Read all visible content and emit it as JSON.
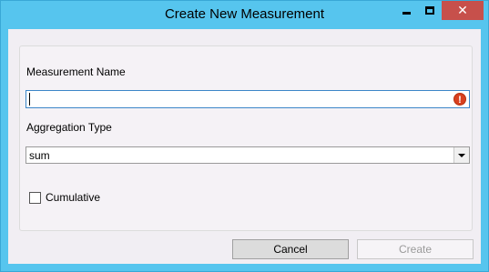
{
  "window": {
    "title": "Create New Measurement",
    "close_glyph": "✕"
  },
  "form": {
    "name_label": "Measurement Name",
    "name_value": "",
    "name_error_glyph": "!",
    "aggregation_label": "Aggregation Type",
    "aggregation_value": "sum",
    "cumulative_label": "Cumulative",
    "cumulative_checked": false
  },
  "buttons": {
    "cancel_label": "Cancel",
    "create_label": "Create"
  },
  "colors": {
    "titlebar": "#56c5ee",
    "close_button": "#c7504b",
    "error_icon": "#d8401f",
    "input_focus_border": "#3c86c8"
  }
}
